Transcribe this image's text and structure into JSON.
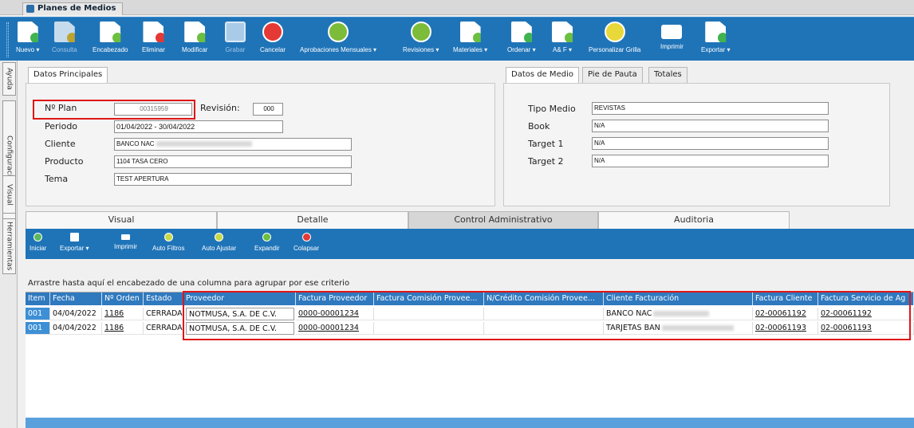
{
  "window": {
    "tab_title": "Planes de Medios"
  },
  "toolbar": [
    {
      "label": "Nuevo ▾",
      "icon": "new-doc-icon",
      "enabled": true
    },
    {
      "label": "Consulta",
      "icon": "query-doc-icon",
      "enabled": false
    },
    {
      "label": "Encabezado",
      "icon": "header-edit-icon",
      "enabled": true
    },
    {
      "label": "Eliminar",
      "icon": "delete-doc-icon",
      "enabled": true
    },
    {
      "label": "Modificar",
      "icon": "edit-doc-icon",
      "enabled": true
    },
    {
      "label": "Grabar",
      "icon": "save-icon",
      "enabled": false
    },
    {
      "label": "Cancelar",
      "icon": "cancel-icon",
      "enabled": true
    },
    {
      "label": "Aprobaciones Mensuales ▾",
      "icon": "thumbs-up-icon",
      "enabled": true
    },
    {
      "label": "Revisiones ▾",
      "icon": "thumbs-up-icon",
      "enabled": true
    },
    {
      "label": "Materiales ▾",
      "icon": "materials-icon",
      "enabled": true
    },
    {
      "label": "Ordenar ▾",
      "icon": "order-icon",
      "enabled": true
    },
    {
      "label": "A& F ▾",
      "icon": "af-icon",
      "enabled": true
    },
    {
      "label": "Personalizar Grilla",
      "icon": "grid-settings-icon",
      "enabled": true
    },
    {
      "label": "Imprimir",
      "icon": "printer-icon",
      "enabled": true
    },
    {
      "label": "Exportar ▾",
      "icon": "export-icon",
      "enabled": true
    }
  ],
  "side_tabs": [
    "Ayuda",
    "Configuraciones",
    "Visual",
    "Herramientas"
  ],
  "datos_principales": {
    "tab": "Datos Principales",
    "nplan_label": "Nº Plan",
    "nplan_value": "00315959",
    "revision_label": "Revisión:",
    "revision_value": "000",
    "periodo_label": "Periodo",
    "periodo_value": "01/04/2022 - 30/04/2022",
    "cliente_label": "Cliente",
    "cliente_value": "BANCO NAC",
    "producto_label": "Producto",
    "producto_value": "1104 TASA CERO",
    "tema_label": "Tema",
    "tema_value": "TEST APERTURA"
  },
  "datos_medio": {
    "tabs": [
      "Datos de Medio",
      "Pie de Pauta",
      "Totales"
    ],
    "fields": [
      {
        "label": "Tipo Medio",
        "value": "REVISTAS"
      },
      {
        "label": "Book",
        "value": "N/A"
      },
      {
        "label": "Target 1",
        "value": "N/A"
      },
      {
        "label": "Target 2",
        "value": "N/A"
      }
    ]
  },
  "main_tabs": [
    "Visual",
    "Detalle",
    "Control Administrativo",
    "Auditoria"
  ],
  "grid_toolbar": [
    "Iniciar",
    "Exportar ▾",
    "Imprimir",
    "Auto Filtros",
    "Auto Ajustar",
    "Expandir",
    "Colapsar"
  ],
  "group_hint": "Arrastre hasta aquí el encabezado de una columna para agrupar por ese criterio",
  "grid": {
    "headers": [
      "Item",
      "Fecha",
      "Nº Orden",
      "Estado",
      "Proveedor",
      "Factura Proveedor",
      "Factura Comisión Provee...",
      "N/Crédito Comisión Provee...",
      "Cliente Facturación",
      "Factura Cliente",
      "Factura Servicio de Ag"
    ],
    "rows": [
      [
        "001",
        "04/04/2022",
        "1186",
        "CERRADA",
        "NOTMUSA, S.A. DE C.V.",
        "0000-00001234",
        "",
        "",
        "BANCO NAC",
        "02-00061192",
        "02-00061192"
      ],
      [
        "001",
        "04/04/2022",
        "1186",
        "CERRADA",
        "NOTMUSA, S.A. DE C.V.",
        "0000-00001234",
        "",
        "",
        "TARJETAS BAN",
        "02-00061193",
        "02-00061193"
      ]
    ]
  },
  "colors": {
    "toolbar_blue": "#1f74b8",
    "highlight_red": "#e01515",
    "header_blue": "#2f79bf"
  }
}
